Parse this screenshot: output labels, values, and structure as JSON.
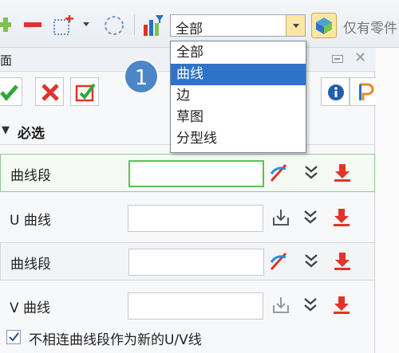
{
  "toolbar": {
    "filter_combo": {
      "value": "全部"
    },
    "only_text": "仅有零件",
    "icons": [
      "plus-icon",
      "minus-icon",
      "add-point-icon",
      "dropdown-arrow-icon",
      "dashed-circle-icon",
      "bar-chart-filter-icon",
      "shape-select-icon"
    ]
  },
  "dropdown": {
    "options": [
      "全部",
      "曲线",
      "边",
      "草图",
      "分型线"
    ],
    "selected": "曲线"
  },
  "badge": {
    "number": "1"
  },
  "panel": {
    "title": "面",
    "section_title": "必选",
    "rows": [
      {
        "label": "曲线段",
        "state": "active",
        "icons": [
          "pick-curve-icon",
          "chevron-down-icon",
          "download-red-icon"
        ]
      },
      {
        "label": "U 曲线",
        "state": "normal",
        "icons": [
          "import-icon",
          "chevron-down-icon",
          "download-red-icon"
        ]
      },
      {
        "label": "曲线段",
        "state": "box",
        "icons": [
          "pick-curve-icon",
          "chevron-down-icon",
          "download-red-icon"
        ]
      },
      {
        "label": "V 曲线",
        "state": "normal",
        "icons": [
          "import-icon",
          "chevron-down-icon",
          "download-red-icon"
        ]
      }
    ],
    "checkbox": {
      "label": "不相连曲线段作为新的U/V线",
      "checked": true
    }
  },
  "colors": {
    "accent": "#2f73c8",
    "ok_green": "#2fa83a",
    "cancel_red": "#e0332b",
    "active_border": "#5bc05a"
  }
}
